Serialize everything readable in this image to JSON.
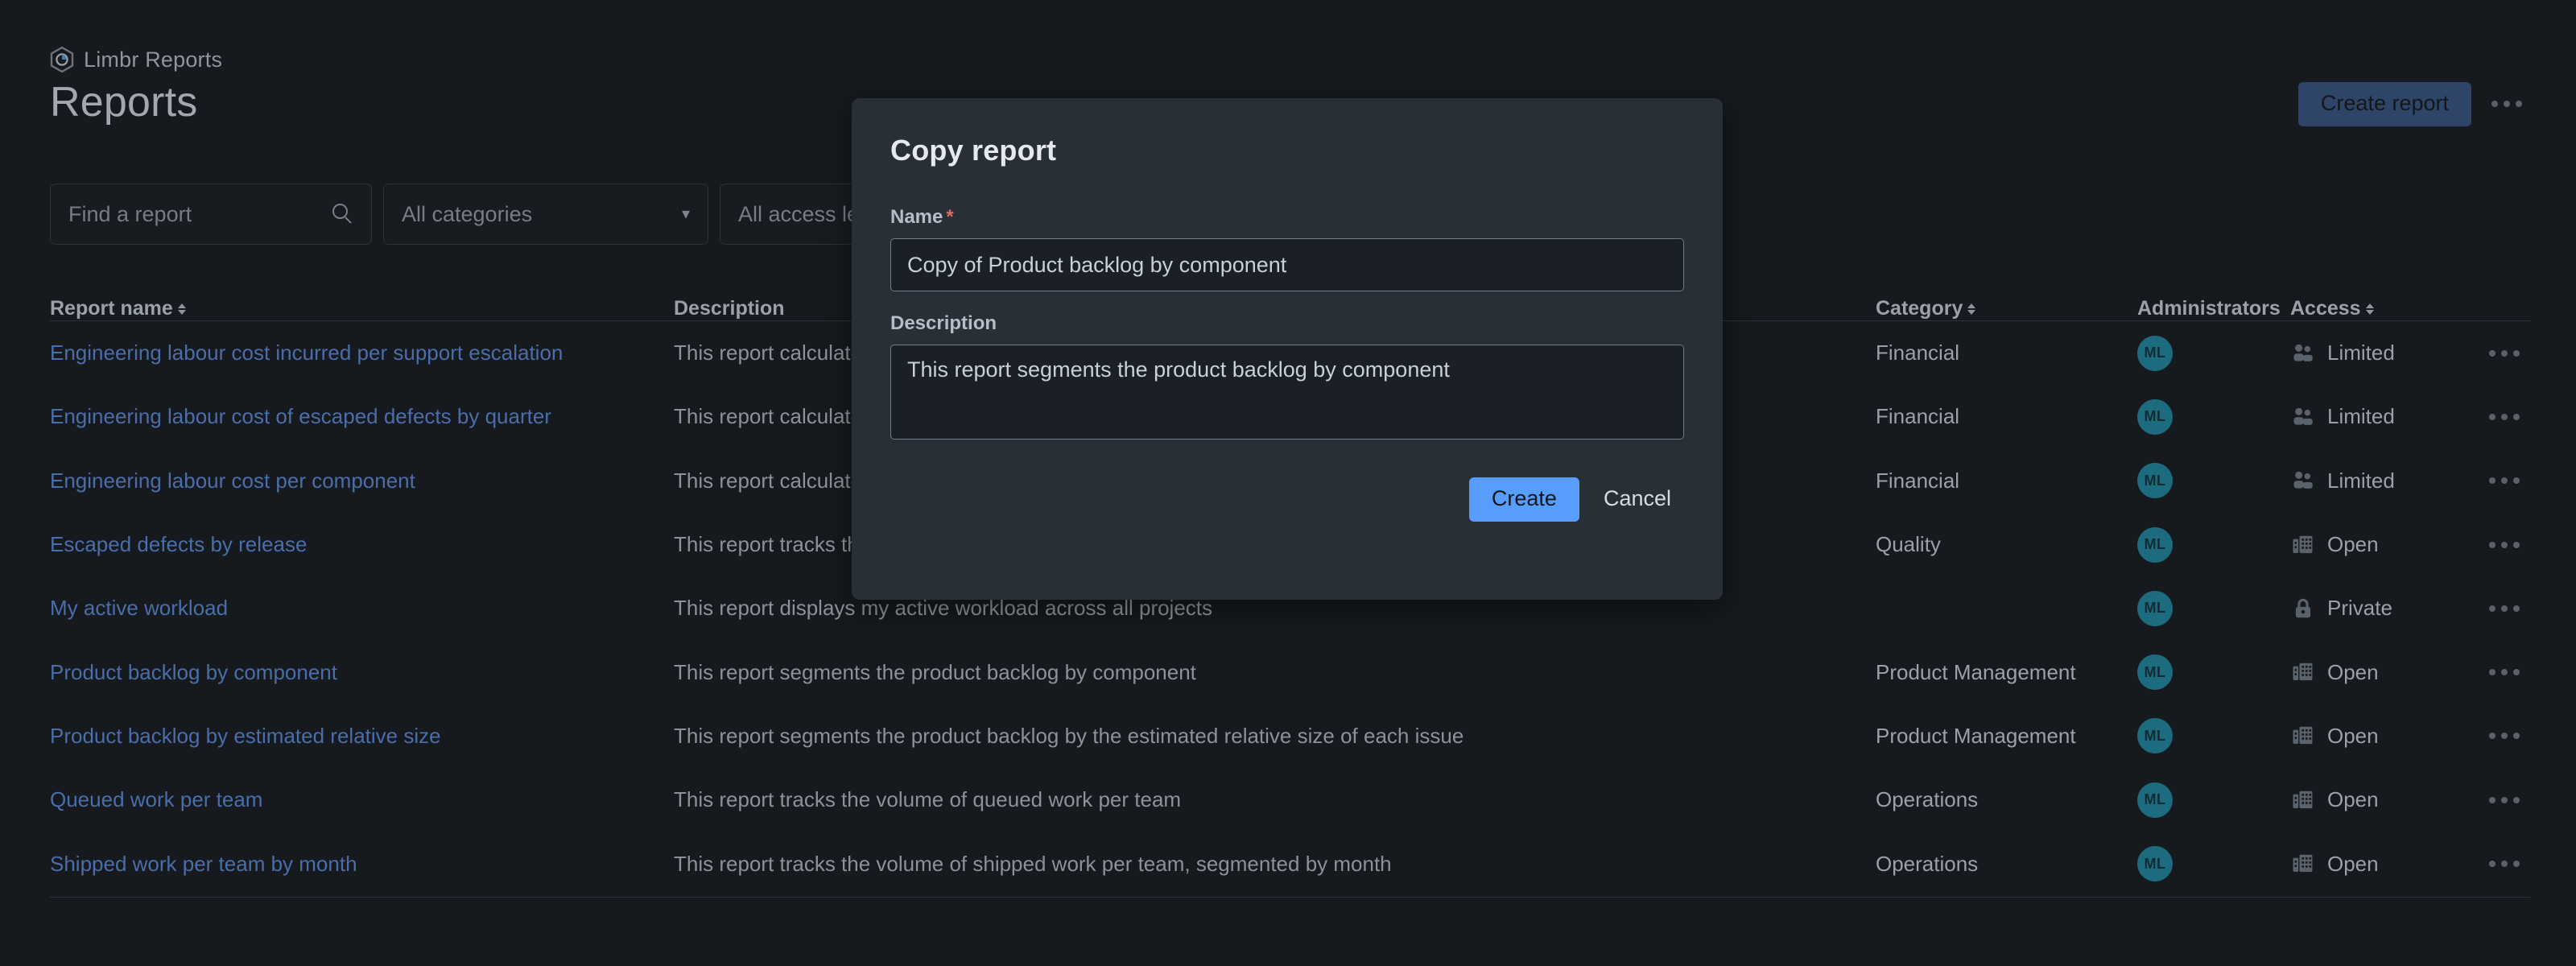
{
  "header": {
    "brand": "Limbr Reports",
    "brand_logo_icon": "limbr-hexagon-logo-icon",
    "page_title": "Reports",
    "create_report_label": "Create report",
    "more_menu_icon": "ellipsis-icon"
  },
  "filters": {
    "search_placeholder": "Find a report",
    "search_value": "",
    "search_icon": "search-icon",
    "category_value": "All categories",
    "category_chevron_icon": "chevron-down-icon",
    "access_value": "All access levels"
  },
  "table": {
    "columns": [
      {
        "label": "Report name",
        "sortable": true
      },
      {
        "label": "Description",
        "sortable": false
      },
      {
        "label": "Category",
        "sortable": true
      },
      {
        "label": "Administrators",
        "sortable": false
      },
      {
        "label": "Access",
        "sortable": true
      }
    ],
    "rows": [
      {
        "name": "Engineering labour cost incurred per support escalation",
        "description": "This report calculates the engineering labour cost incurred per support escalation",
        "category": "Financial",
        "admin_initials": "ML",
        "access": "Limited",
        "access_icon": "people-icon",
        "row_menu_icon": "ellipsis-icon"
      },
      {
        "name": "Engineering labour cost of escaped defects by quarter",
        "description": "This report calculates the engineering labour cost of escaped defects by quarter",
        "category": "Financial",
        "admin_initials": "ML",
        "access": "Limited",
        "access_icon": "people-icon",
        "row_menu_icon": "ellipsis-icon"
      },
      {
        "name": "Engineering labour cost per component",
        "description": "This report calculates the engineering labour cost per component",
        "category": "Financial",
        "admin_initials": "ML",
        "access": "Limited",
        "access_icon": "people-icon",
        "row_menu_icon": "ellipsis-icon"
      },
      {
        "name": "Escaped defects by release",
        "description": "This report tracks the volume of escaped defects by release",
        "category": "Quality",
        "admin_initials": "ML",
        "access": "Open",
        "access_icon": "building-icon",
        "row_menu_icon": "ellipsis-icon"
      },
      {
        "name": "My active workload",
        "description": "This report displays my active workload across all projects",
        "category": "",
        "admin_initials": "ML",
        "access": "Private",
        "access_icon": "lock-icon",
        "row_menu_icon": "ellipsis-icon"
      },
      {
        "name": "Product backlog by component",
        "description": "This report segments the product backlog by component",
        "category": "Product Management",
        "admin_initials": "ML",
        "access": "Open",
        "access_icon": "building-icon",
        "row_menu_icon": "ellipsis-icon"
      },
      {
        "name": "Product backlog by estimated relative size",
        "description": "This report segments the product backlog by the estimated relative size of each issue",
        "category": "Product Management",
        "admin_initials": "ML",
        "access": "Open",
        "access_icon": "building-icon",
        "row_menu_icon": "ellipsis-icon"
      },
      {
        "name": "Queued work per team",
        "description": "This report tracks the volume of queued work per team",
        "category": "Operations",
        "admin_initials": "ML",
        "access": "Open",
        "access_icon": "building-icon",
        "row_menu_icon": "ellipsis-icon"
      },
      {
        "name": "Shipped work per team by month",
        "description": "This report tracks the volume of shipped work per team, segmented by month",
        "category": "Operations",
        "admin_initials": "ML",
        "access": "Open",
        "access_icon": "building-icon",
        "row_menu_icon": "ellipsis-icon"
      }
    ]
  },
  "modal": {
    "title": "Copy report",
    "name_label": "Name",
    "name_required_marker": "*",
    "name_value": "Copy of Product backlog by component",
    "description_label": "Description",
    "description_value": "This report segments the product backlog by component",
    "create_label": "Create",
    "cancel_label": "Cancel"
  },
  "colors": {
    "page_background": "#16191d",
    "modal_background": "#292f37",
    "link": "#4a6ea9",
    "primary_button": "#579dfb",
    "primary_button_dimmed": "#2e4568",
    "avatar": "#1d6b7e",
    "required_marker": "#e06c5c"
  }
}
